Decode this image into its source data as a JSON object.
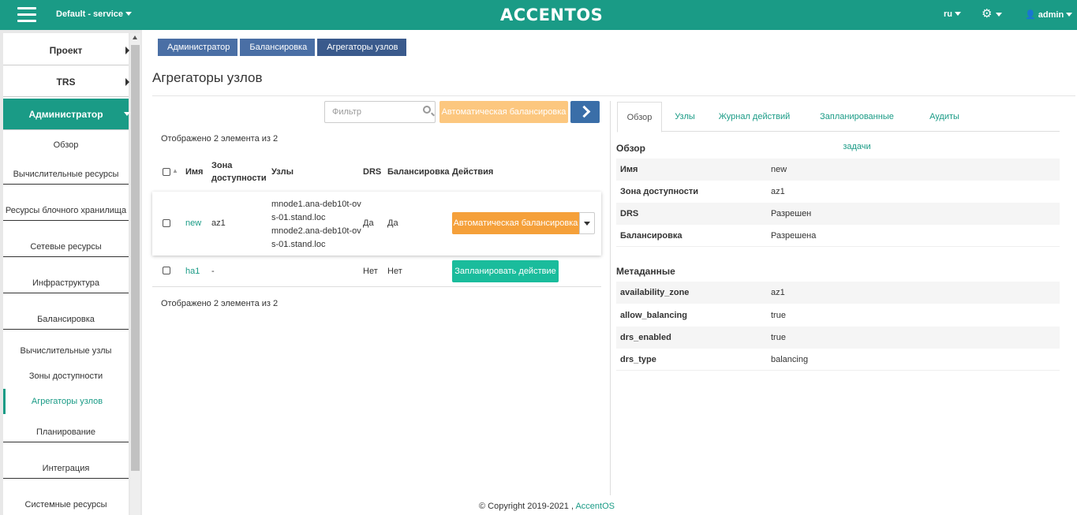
{
  "topbar": {
    "project": "Default - service",
    "logo": "ACCENTOS",
    "lang": "ru",
    "user": "admin",
    "menu_icon": "hamburger-icon",
    "settings_icon": "gear-icon",
    "user_icon": "user-icon"
  },
  "sidebar": {
    "menus": [
      {
        "label": "Проект"
      },
      {
        "label": "TRS"
      },
      {
        "label": "Администратор"
      }
    ],
    "items": [
      "Обзор",
      "Вычислительные ресурсы",
      "Ресурсы блочного хранилища",
      "Сетевые ресурсы",
      "Инфраструктура",
      "Балансировка"
    ],
    "subitems": [
      "Вычислительные узлы",
      "Зоны доступности",
      "Агрегаторы узлов"
    ],
    "items2": [
      "Планирование",
      "Интеграция",
      "Системные ресурсы"
    ]
  },
  "breadcrumb": [
    "Администратор",
    "Балансировка",
    "Агрегаторы узлов"
  ],
  "page_title": "Агрегаторы узлов",
  "toolbar": {
    "filter_placeholder": "Фильтр",
    "auto_balance_label": "Автоматическая балансировка"
  },
  "table": {
    "shown_text": "Отображено 2 элемента из 2",
    "headers": {
      "name": "Имя",
      "zone_1": "Зона",
      "zone_2": "доступности",
      "nodes": "Узлы",
      "drs": "DRS",
      "balancing": "Балансировка",
      "actions": "Действия"
    },
    "rows": [
      {
        "name": "new",
        "zone": "az1",
        "nodes": [
          "mnode1.ana-deb10t-ov",
          "s-01.stand.loc",
          "mnode2.ana-deb10t-ov",
          "s-01.stand.loc"
        ],
        "drs": "Да",
        "balancing": "Да",
        "action": "Автоматическая балансировка"
      },
      {
        "name": "ha1",
        "zone": "-",
        "nodes": [],
        "drs": "Нет",
        "balancing": "Нет",
        "action": "Запланировать действие"
      }
    ]
  },
  "details": {
    "tabs": [
      "Обзор",
      "Узлы",
      "Журнал действий",
      "Запланированные задачи",
      "Аудиты"
    ],
    "overview_title": "Обзор",
    "overview": [
      {
        "k": "Имя",
        "v": "new"
      },
      {
        "k": "Зона доступности",
        "v": "az1"
      },
      {
        "k": "DRS",
        "v": "Разрешен"
      },
      {
        "k": "Балансировка",
        "v": "Разрешена"
      }
    ],
    "metadata_title": "Метаданные",
    "metadata": [
      {
        "k": "availability_zone",
        "v": "az1"
      },
      {
        "k": "allow_balancing",
        "v": "true"
      },
      {
        "k": "drs_enabled",
        "v": "true"
      },
      {
        "k": "drs_type",
        "v": "balancing"
      }
    ]
  },
  "footer": {
    "text": "© Copyright 2019-2021 ,",
    "brand": "AccentOS"
  }
}
